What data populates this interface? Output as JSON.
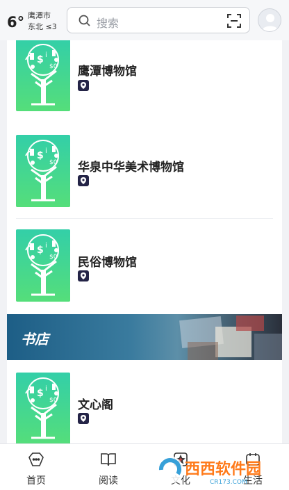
{
  "header": {
    "temperature": "6°",
    "city": "鹰潭市",
    "wind": "东北 ≤3",
    "search_placeholder": "搜索"
  },
  "museums": [
    {
      "name": "鹰潭博物馆"
    },
    {
      "name": "华泉中华美术博物馆"
    },
    {
      "name": "民俗博物馆"
    }
  ],
  "section": {
    "title": "书店"
  },
  "bookstores": [
    {
      "name": "文心阁"
    }
  ],
  "bottom_nav": [
    {
      "label": "首页",
      "icon": "home-icon"
    },
    {
      "label": "阅读",
      "icon": "book-icon"
    },
    {
      "label": "文化",
      "icon": "culture-icon"
    },
    {
      "label": "生活",
      "icon": "life-icon"
    }
  ],
  "watermark": {
    "text": "西西软件园",
    "sub": "CR173.COM"
  },
  "colors": {
    "accent": "#1d5e86",
    "thumb_top": "#33cfa8",
    "thumb_bottom": "#55de7a",
    "pin": "#242447"
  }
}
